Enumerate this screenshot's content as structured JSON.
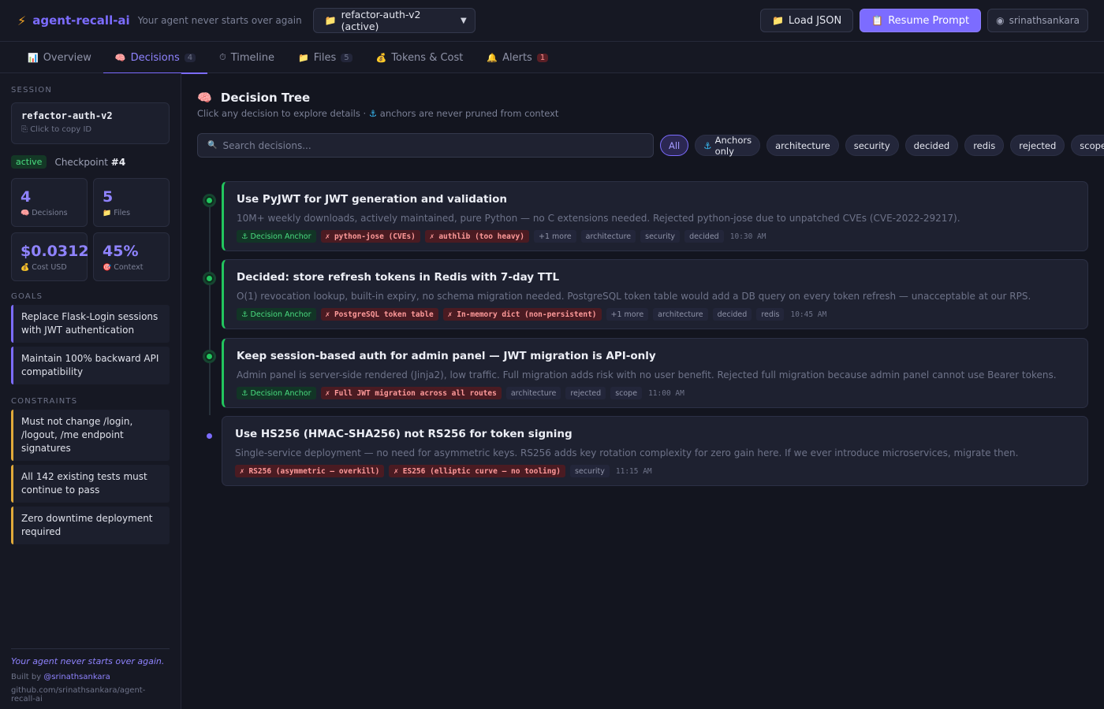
{
  "header": {
    "app_name": "agent-recall-ai",
    "tagline": "Your agent never starts over again",
    "session_selected": "refactor-auth-v2 (active)",
    "load_json_label": "Load JSON",
    "resume_prompt_label": "Resume Prompt",
    "github_user": "srinathsankara"
  },
  "tabs": [
    {
      "label": "Overview",
      "icon": "chart-icon"
    },
    {
      "label": "Decisions",
      "count": "4",
      "icon": "brain-icon"
    },
    {
      "label": "Timeline",
      "icon": "stopwatch-icon"
    },
    {
      "label": "Files",
      "count": "5",
      "icon": "folder-icon"
    },
    {
      "label": "Tokens & Cost",
      "icon": "money-bag-icon"
    },
    {
      "label": "Alerts",
      "count": "1",
      "icon": "bell-icon"
    }
  ],
  "sidebar": {
    "session_label": "Session",
    "session_id": "refactor-auth-v2",
    "copy_hint": "Click to copy ID",
    "status": "active",
    "checkpoint_label": "Checkpoint",
    "checkpoint_value": "#4",
    "stats": [
      {
        "value": "4",
        "label": "Decisions"
      },
      {
        "value": "5",
        "label": "Files"
      },
      {
        "value": "$0.0312",
        "label": "Cost USD"
      },
      {
        "value": "45%",
        "label": "Context"
      }
    ],
    "goals_label": "Goals",
    "goals": [
      "Replace Flask-Login sessions with JWT authentication",
      "Maintain 100% backward API compatibility"
    ],
    "constraints_label": "Constraints",
    "constraints": [
      "Must not change /login, /logout, /me endpoint signatures",
      "All 142 existing tests must continue to pass",
      "Zero downtime deployment required"
    ],
    "footer_tagline": "Your agent never starts over again.",
    "footer_built_prefix": "Built by",
    "footer_built_link": "@srinathsankara",
    "footer_url": "github.com/srinathsankara/agent-recall-ai"
  },
  "main": {
    "title": "Decision Tree",
    "subtitle_prefix": "Click any decision to explore details ·",
    "subtitle_suffix": "anchors are never pruned from context",
    "search_placeholder": "Search decisions...",
    "filters": [
      "All",
      "Anchors only",
      "architecture",
      "security",
      "decided",
      "redis",
      "rejected",
      "scope"
    ],
    "decisions": [
      {
        "title": "Use PyJWT for JWT generation and validation",
        "desc": "10M+ weekly downloads, actively maintained, pure Python — no C extensions needed. Rejected python-jose due to unpatched CVEs (CVE-2022-29217).",
        "anchor": "Decision Anchor",
        "rejected": [
          "✗ python-jose (CVEs)",
          "✗ authlib (too heavy)"
        ],
        "more": "+1 more",
        "tags": [
          "architecture",
          "security",
          "decided"
        ],
        "time": "10:30 AM"
      },
      {
        "title": "Decided: store refresh tokens in Redis with 7-day TTL",
        "desc": "O(1) revocation lookup, built-in expiry, no schema migration needed. PostgreSQL token table would add a DB query on every token refresh — unacceptable at our RPS.",
        "anchor": "Decision Anchor",
        "rejected": [
          "✗ PostgreSQL token table",
          "✗ In-memory dict (non-persistent)"
        ],
        "more": "+1 more",
        "tags": [
          "architecture",
          "decided",
          "redis"
        ],
        "time": "10:45 AM"
      },
      {
        "title": "Keep session-based auth for admin panel — JWT migration is API-only",
        "desc": "Admin panel is server-side rendered (Jinja2), low traffic. Full migration adds risk with no user benefit. Rejected full migration because admin panel cannot use Bearer tokens.",
        "anchor": "Decision Anchor",
        "rejected": [
          "✗ Full JWT migration across all routes"
        ],
        "tags": [
          "architecture",
          "rejected",
          "scope"
        ],
        "time": "11:00 AM"
      },
      {
        "title": "Use HS256 (HMAC-SHA256) not RS256 for token signing",
        "desc": "Single-service deployment — no need for asymmetric keys. RS256 adds key rotation complexity for zero gain here. If we ever introduce microservices, migrate then.",
        "rejected": [
          "✗ RS256 (asymmetric — overkill)",
          "✗ ES256 (elliptic curve — no tooling)"
        ],
        "tags": [
          "security"
        ],
        "time": "11:15 AM"
      }
    ]
  }
}
